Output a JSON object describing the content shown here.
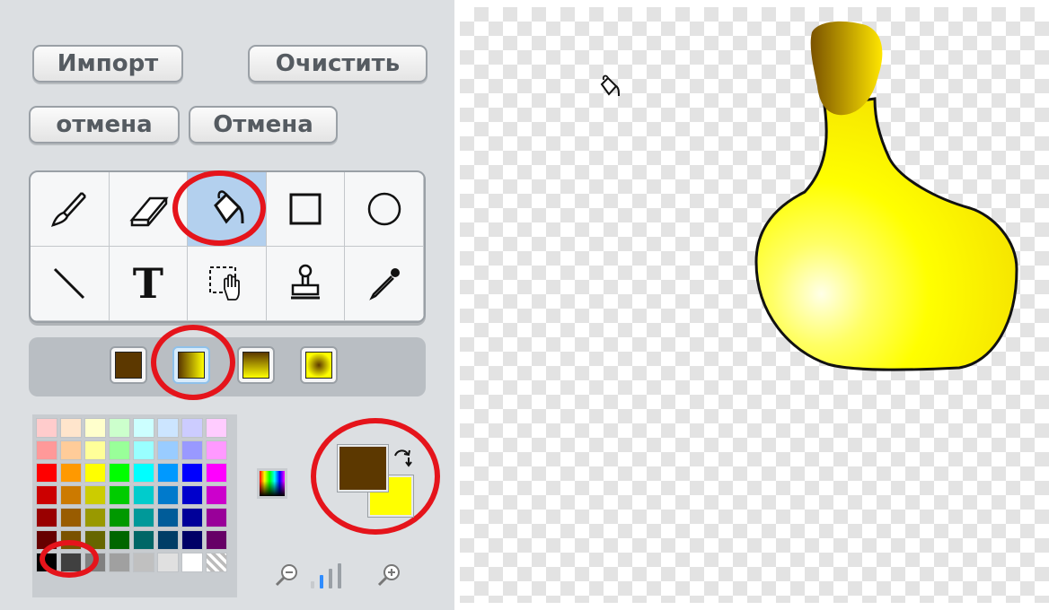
{
  "buttons": {
    "import": "Импорт",
    "clear": "Очистить",
    "undo": "отмена",
    "redo": "Отмена"
  },
  "tools": [
    {
      "name": "brush-tool",
      "icon": "paintbrush-icon"
    },
    {
      "name": "eraser-tool",
      "icon": "eraser-icon"
    },
    {
      "name": "fill-tool",
      "icon": "paint-bucket-icon",
      "selected": true
    },
    {
      "name": "rectangle-tool",
      "icon": "rectangle-icon"
    },
    {
      "name": "ellipse-tool",
      "icon": "ellipse-icon"
    },
    {
      "name": "line-tool",
      "icon": "line-icon"
    },
    {
      "name": "text-tool",
      "icon": "text-icon",
      "glyph": "T"
    },
    {
      "name": "select-tool",
      "icon": "select-hand-icon"
    },
    {
      "name": "stamp-tool",
      "icon": "stamp-icon"
    },
    {
      "name": "eyedropper-tool",
      "icon": "eyedropper-icon"
    }
  ],
  "fill_options": [
    {
      "name": "solid-fill",
      "selected": false
    },
    {
      "name": "horizontal-gradient-fill",
      "selected": true
    },
    {
      "name": "vertical-gradient-fill",
      "selected": false
    },
    {
      "name": "radial-gradient-fill",
      "selected": false
    }
  ],
  "colors": {
    "foreground": "#5c3800",
    "background": "#ffff00",
    "highlight": "#e5141b",
    "selected_palette": "#7a5200"
  },
  "palette": [
    [
      "#ffcccc",
      "#ffe5cc",
      "#ffffcc",
      "#ccffcc",
      "#ccffff",
      "#cce5ff",
      "#ccccff",
      "#ffccff"
    ],
    [
      "#ff9999",
      "#ffcc99",
      "#ffff99",
      "#99ff99",
      "#99ffff",
      "#99ccff",
      "#9999ff",
      "#ff99ff"
    ],
    [
      "#ff0000",
      "#ff9900",
      "#ffff00",
      "#00ff00",
      "#00ffff",
      "#0099ff",
      "#0000ff",
      "#ff00ff"
    ],
    [
      "#cc0000",
      "#cc7a00",
      "#cccc00",
      "#00cc00",
      "#00cccc",
      "#007acc",
      "#0000cc",
      "#cc00cc"
    ],
    [
      "#990000",
      "#995c00",
      "#999900",
      "#009900",
      "#009999",
      "#005c99",
      "#000099",
      "#990099"
    ],
    [
      "#660000",
      "#7a5200",
      "#666600",
      "#006600",
      "#006666",
      "#003d66",
      "#000066",
      "#660066"
    ],
    [
      "#000000",
      "#404040",
      "#808080",
      "#a0a0a0",
      "#c0c0c0",
      "#e0e0e0",
      "#ffffff",
      "transparent"
    ]
  ],
  "zoom": {
    "level_index": 1,
    "levels": 4
  }
}
